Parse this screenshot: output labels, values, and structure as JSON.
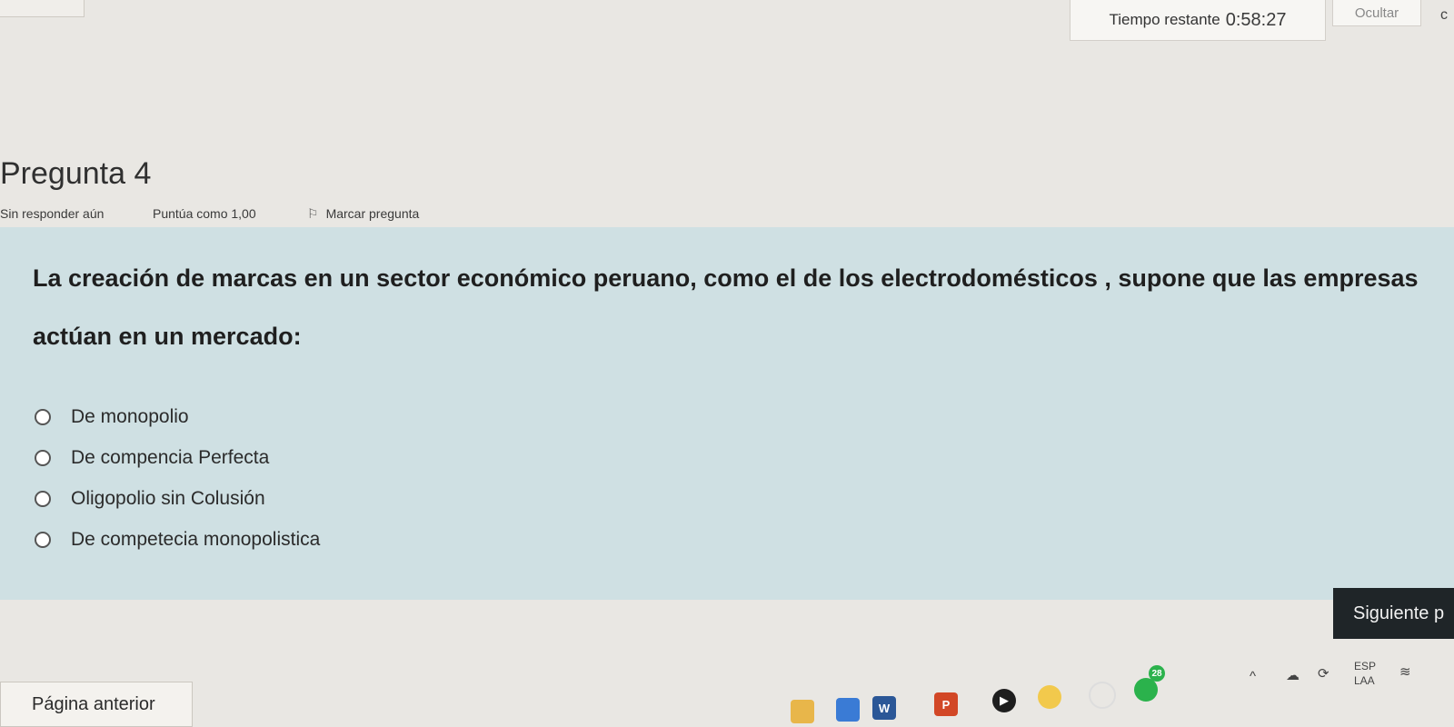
{
  "timer": {
    "label": "Tiempo restante",
    "value": "0:58:27"
  },
  "hide_button": {
    "label": "Ocultar"
  },
  "question": {
    "title": "Pregunta 4",
    "status": "Sin responder aún",
    "grade": "Puntúa como 1,00",
    "flag_label": "Marcar pregunta",
    "text": "La creación de marcas en un sector económico peruano, como el de los electrodomésticos , supone que las empresas actúan en un mercado:",
    "options": [
      {
        "label": "De monopolio"
      },
      {
        "label": "De compencia Perfecta"
      },
      {
        "label": "Oligopolio sin Colusión"
      },
      {
        "label": "De competecia monopolistica"
      }
    ]
  },
  "nav": {
    "next_label": "Siguiente p",
    "prev_label": "Página anterior"
  },
  "taskbar": {
    "language": "ESP",
    "layout": "LAA",
    "notification_count": "28",
    "icons": [
      "file-explorer-icon",
      "store-icon",
      "word-icon",
      "powerpoint-icon",
      "media-player-icon",
      "chrome-icon",
      "search-icon",
      "whatsapp-icon"
    ]
  },
  "colors": {
    "panel": "#cfe0e3",
    "next_button": "#1f2528",
    "background": "#e9e7e3"
  }
}
